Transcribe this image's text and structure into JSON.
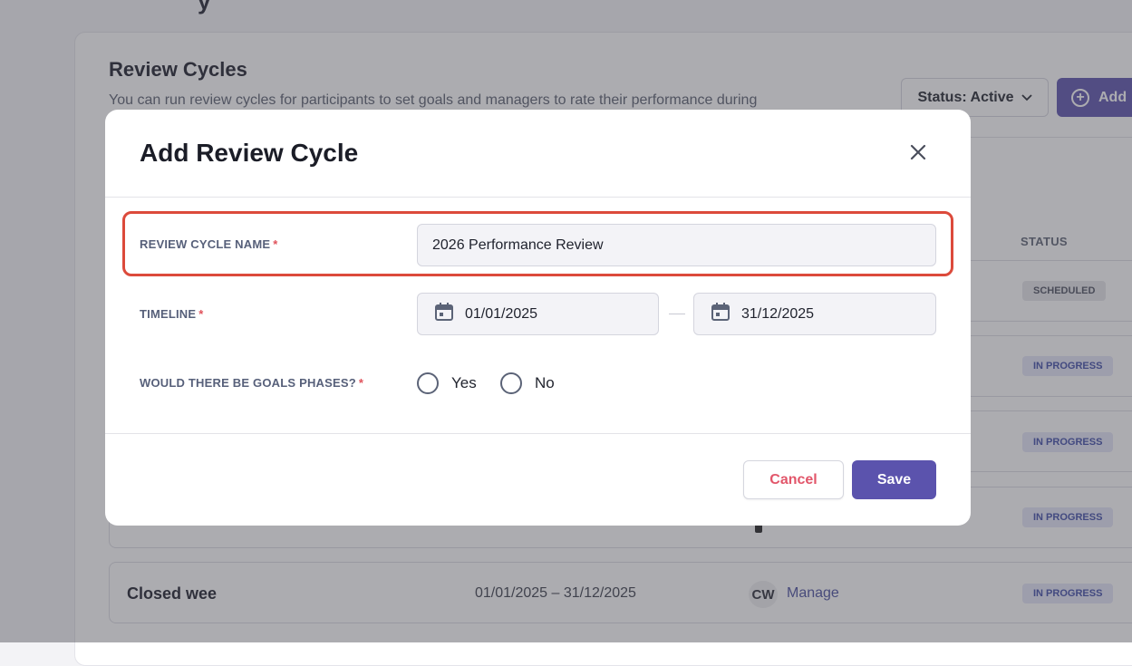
{
  "background": {
    "page_heading_fragment": "y",
    "section_title": "Review Cycles",
    "section_description": "You can run review cycles for participants to set goals and managers to rate their performance during",
    "status_filter_label": "Status: Active",
    "add_button_label": "Add",
    "status_column_header": "STATUS",
    "rows": [
      {
        "status": "SCHEDULED"
      },
      {
        "status": "IN PROGRESS"
      },
      {
        "status": "IN PROGRESS"
      },
      {
        "status": "IN PROGRESS"
      },
      {
        "name": "Closed wee",
        "dates": "01/01/2025 – 31/12/2025",
        "avatar_initials": "CW",
        "manage_label": "Manage",
        "status": "IN PROGRESS"
      }
    ]
  },
  "modal": {
    "title": "Add Review Cycle",
    "fields": {
      "name": {
        "label": "REVIEW CYCLE NAME",
        "required_mark": "*",
        "value": "2026 Performance Review"
      },
      "timeline": {
        "label": "TIMELINE",
        "required_mark": "*",
        "start": "01/01/2025",
        "end": "31/12/2025"
      },
      "goals_phases": {
        "label": "WOULD THERE BE GOALS PHASES?",
        "required_mark": "*",
        "options": [
          "Yes",
          "No"
        ]
      }
    },
    "cancel_label": "Cancel",
    "save_label": "Save"
  },
  "colors": {
    "primary": "#5b53ad",
    "highlight": "#dc4a3b",
    "cancel_text": "#e2566a",
    "required": "#e0525b"
  }
}
